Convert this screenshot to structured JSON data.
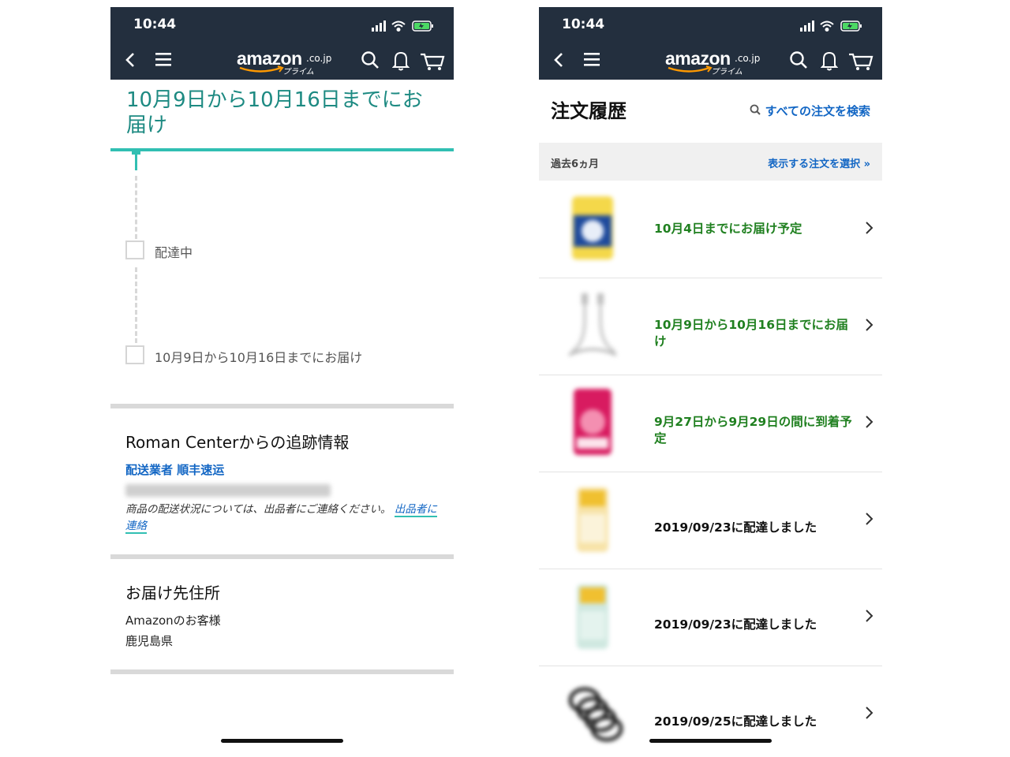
{
  "status_bar": {
    "time": "10:44"
  },
  "brand": {
    "logo_text": "amazon",
    "logo_domain": ".co.jp",
    "logo_sub": "プライム"
  },
  "left": {
    "delivery_heading": "10月9日から10月16日までにお届け",
    "steps": [
      {
        "label": "配達中"
      },
      {
        "label": "10月9日から10月16日までにお届け"
      }
    ],
    "tracking": {
      "title": "Roman Centerからの追跡情報",
      "carrier": "配送業者 順丰速运",
      "note": "商品の配送状況については、出品者にご連絡ください。",
      "contact_link": "出品者に連絡"
    },
    "address": {
      "title": "お届け先住所",
      "name": "Amazonのお客様",
      "region": "鹿児島県"
    }
  },
  "right": {
    "title": "注文履歴",
    "search_link": "すべての注文を検索",
    "filter": {
      "label": "過去6ヵ月",
      "link": "表示する注文を選択 »"
    },
    "orders": [
      {
        "status": "10月4日までにお届け予定",
        "kind": "upcoming"
      },
      {
        "status": "10月9日から10月16日までにお届け",
        "kind": "upcoming"
      },
      {
        "status": "9月27日から9月29日の間に到着予定",
        "kind": "upcoming"
      },
      {
        "status": "2019/09/23に配達しました",
        "kind": "delivered"
      },
      {
        "status": "2019/09/23に配達しました",
        "kind": "delivered"
      },
      {
        "status": "2019/09/25に配達しました",
        "kind": "delivered"
      }
    ]
  },
  "colors": {
    "header_bg": "#232f3e",
    "teal": "#31bfb2",
    "heading_teal": "#1d8a82",
    "link_blue": "#1266c4",
    "status_green": "#208020"
  },
  "icons": [
    "back-icon",
    "menu-icon",
    "search-icon",
    "bell-icon",
    "cart-icon",
    "location-arrow-icon",
    "signal-icon",
    "wifi-icon",
    "battery-icon",
    "chevron-right-icon"
  ]
}
